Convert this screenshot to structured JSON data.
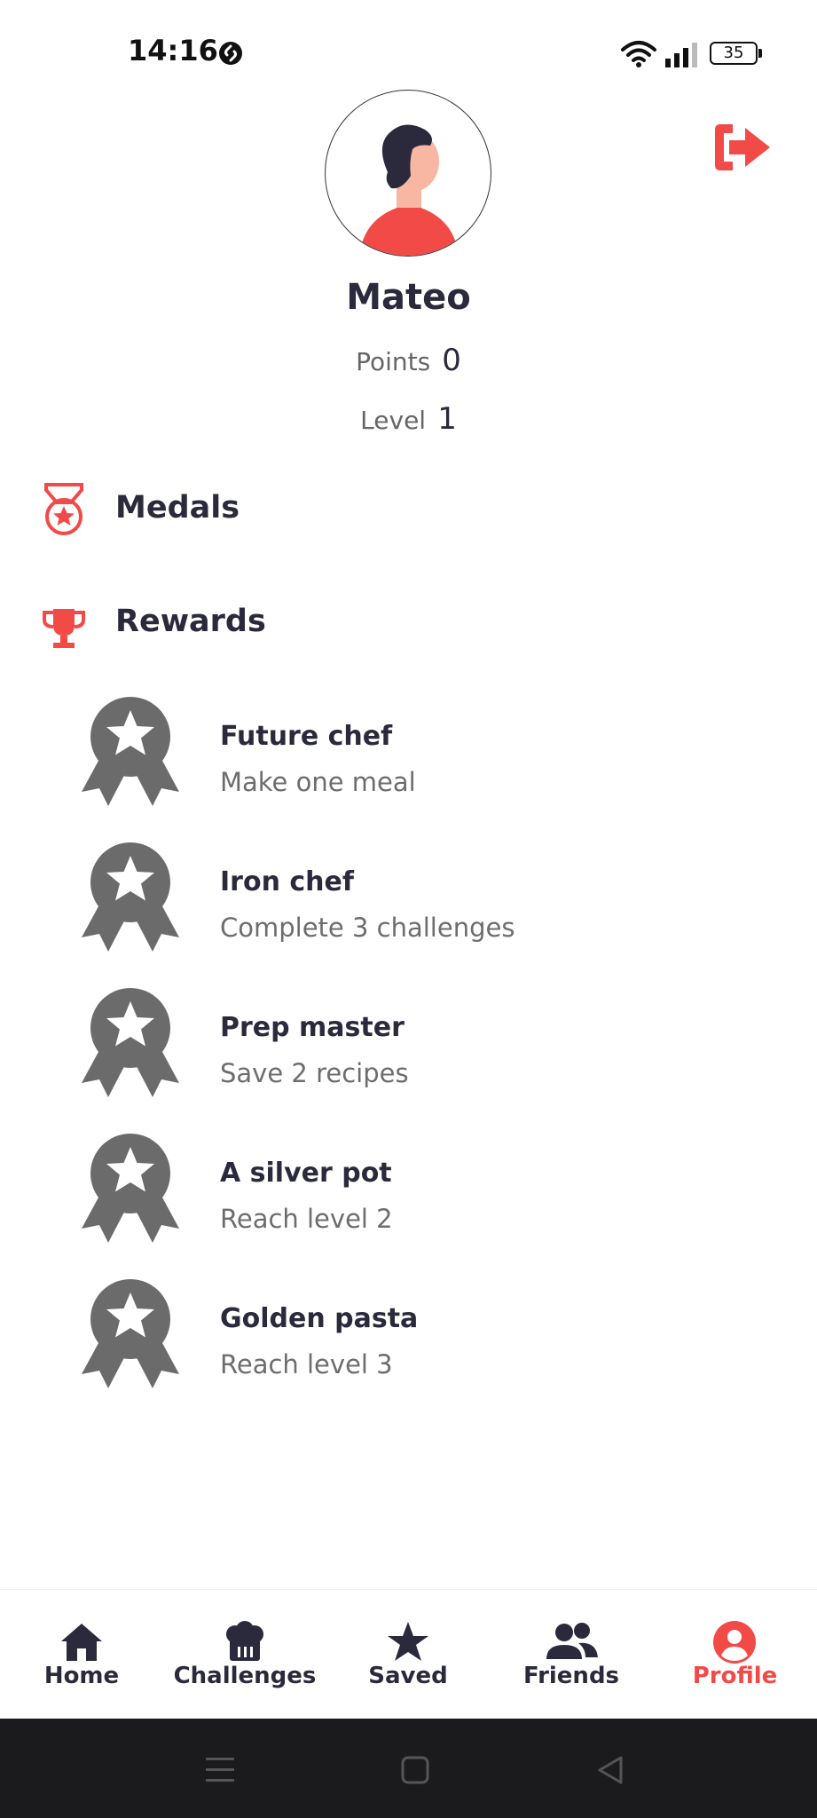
{
  "status_bar": {
    "time": "14:16",
    "battery": "35",
    "icons": [
      "shazam-icon",
      "wifi-icon",
      "signal-icon",
      "battery-icon"
    ]
  },
  "profile": {
    "name": "Mateo",
    "points_label": "Points",
    "points_value": "0",
    "level_label": "Level",
    "level_value": "1"
  },
  "sections": {
    "medals_label": "Medals",
    "rewards_label": "Rewards"
  },
  "rewards": [
    {
      "title": "Future chef",
      "description": "Make one meal"
    },
    {
      "title": "Iron chef",
      "description": "Complete 3 challenges"
    },
    {
      "title": "Prep master",
      "description": "Save 2 recipes"
    },
    {
      "title": "A silver pot",
      "description": "Reach level 2"
    },
    {
      "title": "Golden pasta",
      "description": "Reach level 3"
    }
  ],
  "nav": {
    "items": [
      {
        "label": "Home",
        "icon": "home-icon"
      },
      {
        "label": "Challenges",
        "icon": "chef-hat-icon"
      },
      {
        "label": "Saved",
        "icon": "star-icon"
      },
      {
        "label": "Friends",
        "icon": "users-icon"
      },
      {
        "label": "Profile",
        "icon": "user-circle-icon"
      }
    ],
    "active": "Profile"
  },
  "colors": {
    "accent": "#f24a47",
    "dark": "#2a2a3c",
    "badge_gray": "#6b6b6b",
    "system_nav": "#1b1a1d"
  }
}
